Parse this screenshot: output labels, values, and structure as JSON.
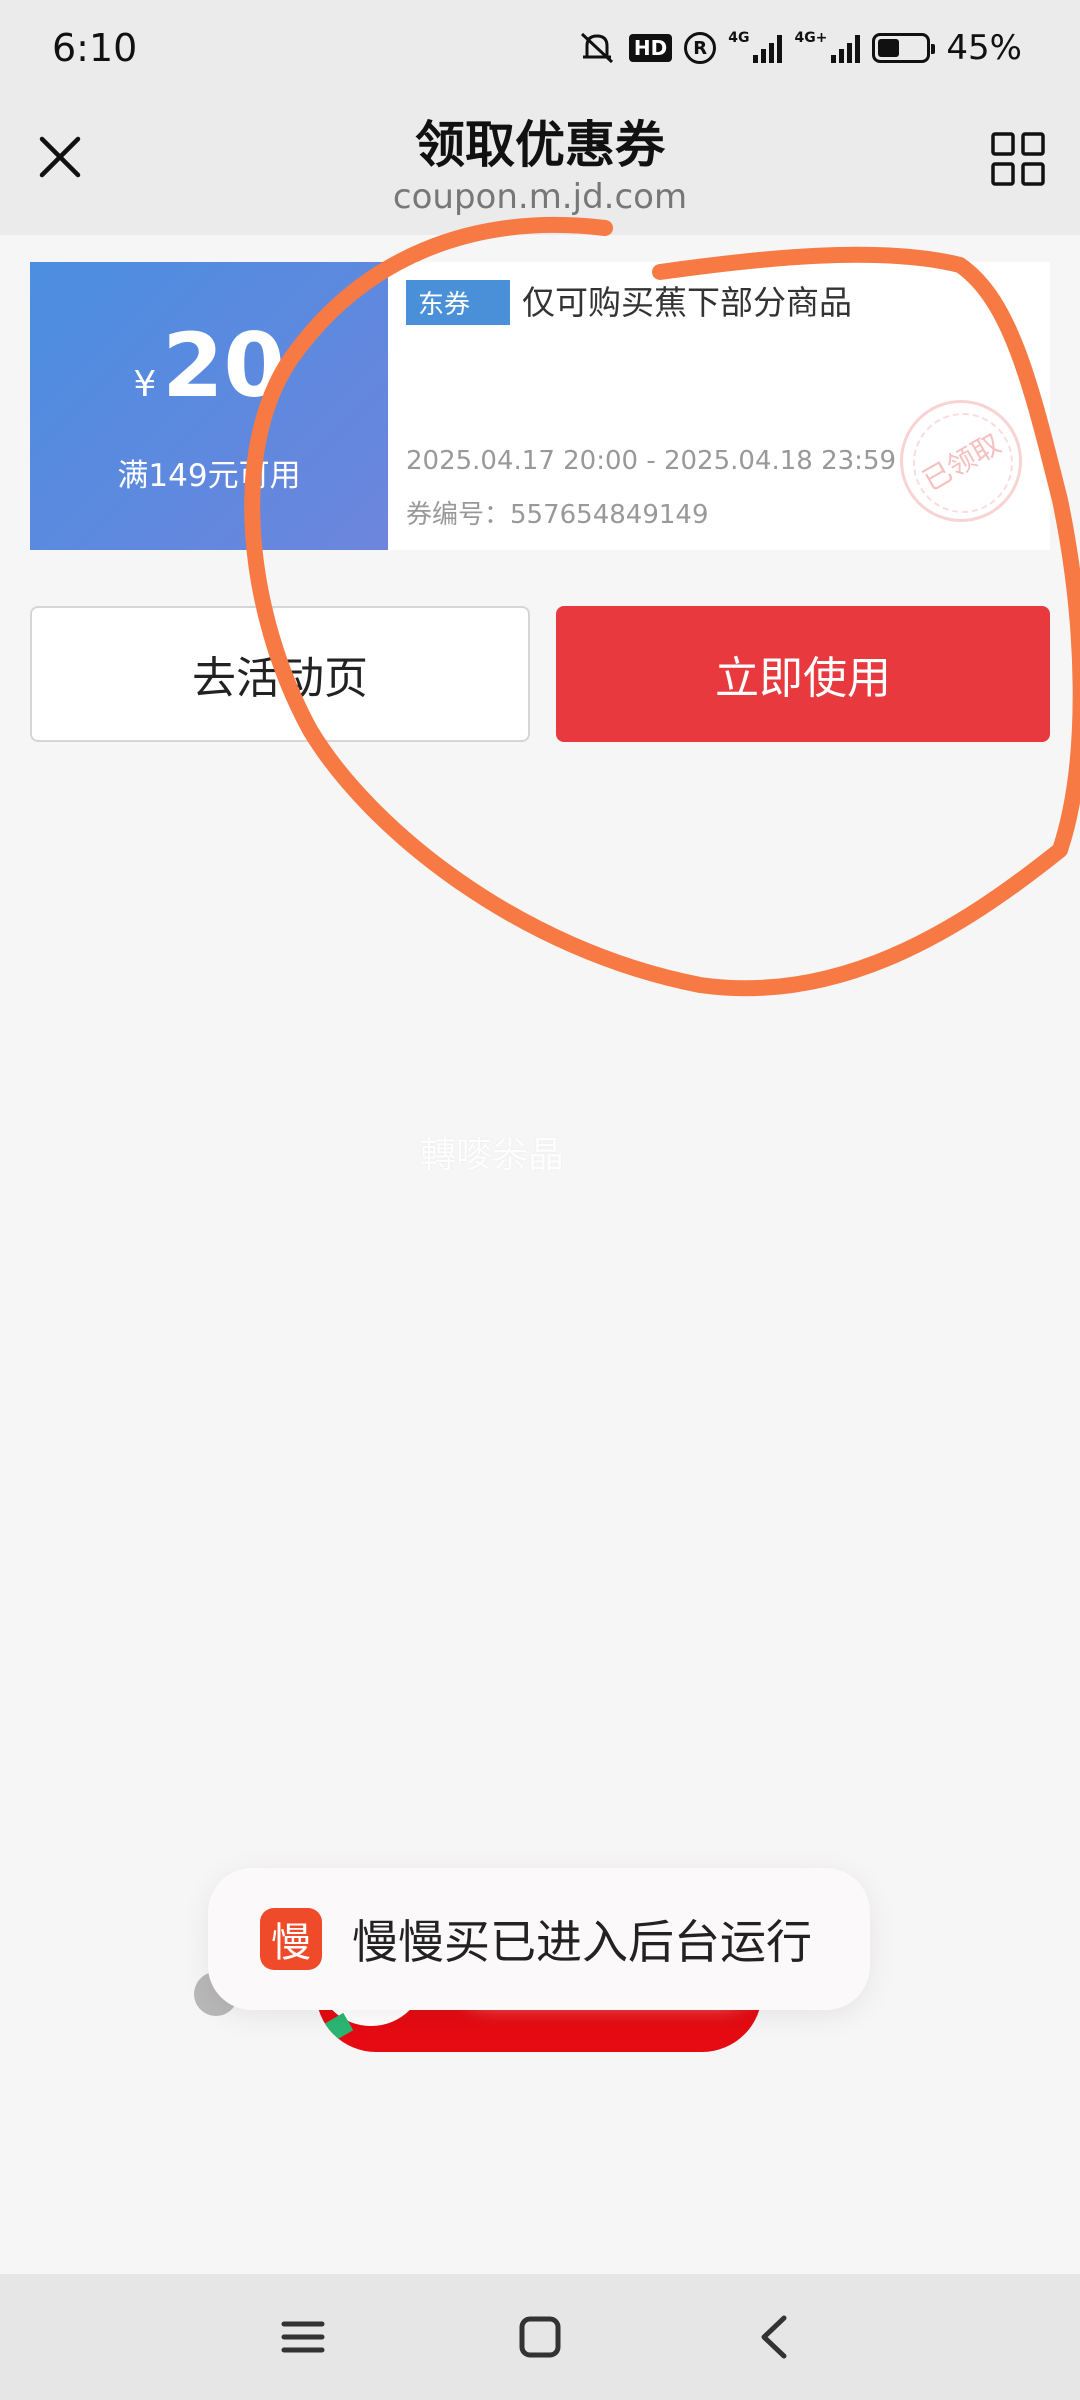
{
  "status_bar": {
    "time": "6:10",
    "hd_label": "HD",
    "r_label": "R",
    "network_1": "4G",
    "network_2": "4G+",
    "battery_text": "45%",
    "battery_level_percent": 45
  },
  "header": {
    "title": "领取优惠券",
    "url": "coupon.m.jd.com"
  },
  "coupon": {
    "currency": "¥",
    "amount": "20",
    "condition": "满149元可用",
    "tag": "东券",
    "description": "仅可购买蕉下部分商品",
    "date_range": "2025.04.17 20:00 - 2025.04.18 23:59",
    "number_text": "券编号：557654849149",
    "stamp_text": "已领取"
  },
  "buttons": {
    "activity": "去活动页",
    "use_now": "立即使用"
  },
  "watermark": "轉嘜尜晶",
  "toast": {
    "icon_text": "慢",
    "message": "慢慢买已进入后台运行"
  },
  "colors": {
    "coupon_blue": "#4b8ee0",
    "use_red": "#e8393f",
    "scribble_orange": "#f77a45",
    "toast_icon": "#ef4a2a"
  },
  "icons": {
    "close": "close-icon",
    "grid": "grid-icon",
    "mute": "mute-bell-icon",
    "menu": "menu-icon",
    "home": "home-icon",
    "back": "back-icon"
  }
}
